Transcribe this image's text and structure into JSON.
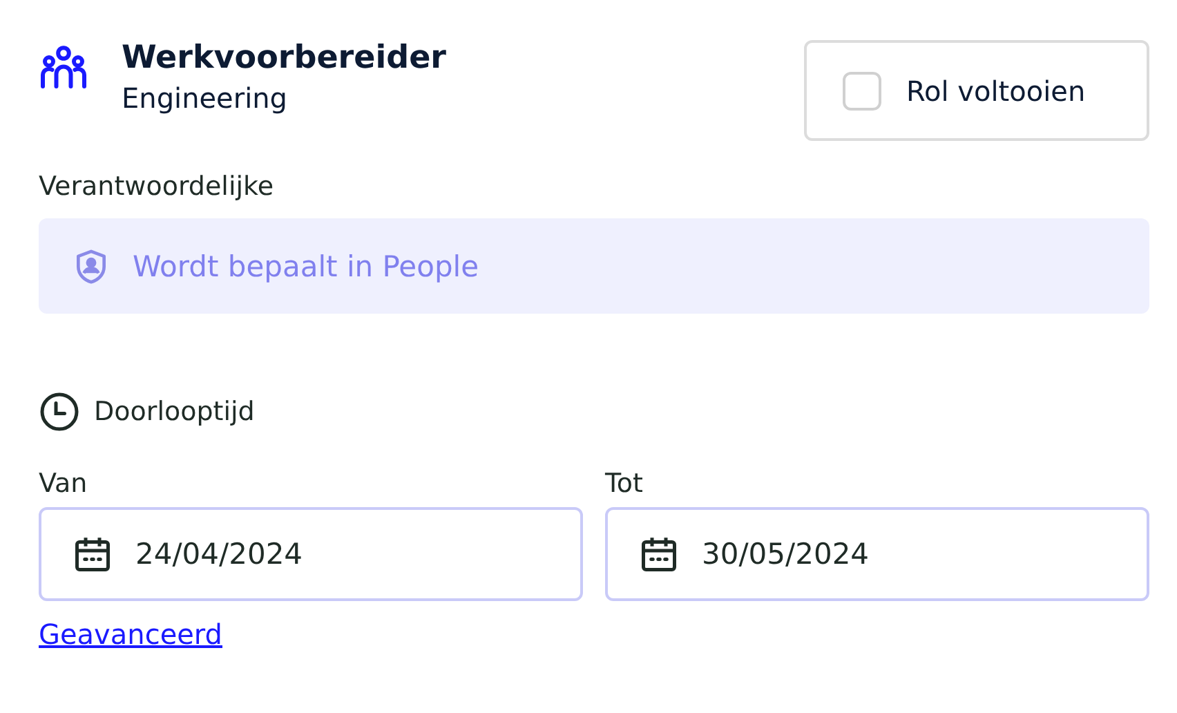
{
  "role": {
    "title": "Werkvoorbereider",
    "department": "Engineering"
  },
  "complete": {
    "label": "Rol voltooien",
    "checked": false
  },
  "owner": {
    "label": "Verantwoordelijke",
    "value": "Wordt bepaalt in People"
  },
  "duration": {
    "label": "Doorlooptijd"
  },
  "dates": [
    {
      "label": "Van",
      "value": "24/04/2024"
    },
    {
      "label": "Tot",
      "value": "30/05/2024"
    }
  ],
  "advanced_link": "Geavanceerd"
}
